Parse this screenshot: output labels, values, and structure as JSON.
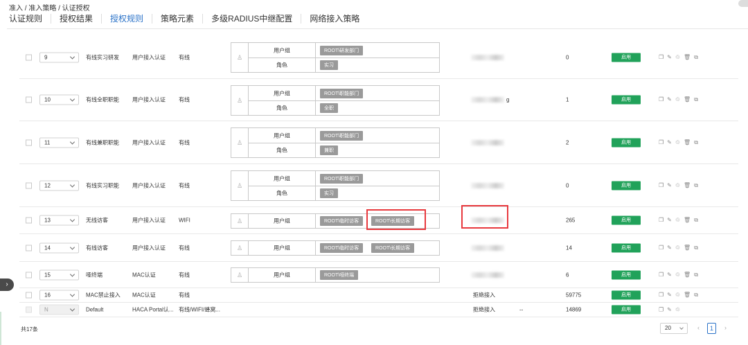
{
  "breadcrumb": "准入 / 准入策略 / 认证授权",
  "tabs": [
    "认证规则",
    "授权结果",
    "授权规则",
    "策略元素",
    "多级RADIUS中继配置",
    "网络接入策略"
  ],
  "active_tab": 2,
  "labels": {
    "user_group": "用户组",
    "role": "角色"
  },
  "rows": [
    {
      "num": "9",
      "name": "有线实习研发",
      "auth": "用户接入认证",
      "conn": "有线",
      "group_tags": [
        "ROOT\\研发部门"
      ],
      "role_tags": [
        "实习"
      ],
      "result": "",
      "count": "0",
      "status": "启用"
    },
    {
      "num": "10",
      "name": "有线全职职能",
      "auth": "用户接入认证",
      "conn": "有线",
      "group_tags": [
        "ROOT\\职能部门"
      ],
      "role_tags": [
        "全职"
      ],
      "result": "g",
      "count": "1",
      "status": "启用"
    },
    {
      "num": "11",
      "name": "有线兼职职能",
      "auth": "用户接入认证",
      "conn": "有线",
      "group_tags": [
        "ROOT\\职能部门"
      ],
      "role_tags": [
        "兼职"
      ],
      "result": "",
      "count": "2",
      "status": "启用"
    },
    {
      "num": "12",
      "name": "有线实习职能",
      "auth": "用户接入认证",
      "conn": "有线",
      "group_tags": [
        "ROOT\\职能部门"
      ],
      "role_tags": [
        "实习"
      ],
      "result": "",
      "count": "0",
      "status": "启用"
    },
    {
      "num": "13",
      "name": "无线访客",
      "auth": "用户接入认证",
      "conn": "WIFI",
      "group_tags": [
        "ROOT\\临时访客",
        "ROOT\\长期访客"
      ],
      "role_tags": [],
      "result": "",
      "count": "265",
      "status": "启用"
    },
    {
      "num": "14",
      "name": "有线访客",
      "auth": "用户接入认证",
      "conn": "有线",
      "group_tags": [
        "ROOT\\临时访客",
        "ROOT\\长期访客"
      ],
      "role_tags": [],
      "result": "",
      "count": "14",
      "status": "启用"
    },
    {
      "num": "15",
      "name": "哑终端",
      "auth": "MAC认证",
      "conn": "有线",
      "group_tags": [
        "ROOT\\哑终端"
      ],
      "role_tags": [],
      "result": "",
      "count": "6",
      "status": "启用"
    },
    {
      "num": "16",
      "name": "MAC禁止接入",
      "auth": "MAC认证",
      "conn": "有线",
      "group_tags": [],
      "role_tags": [],
      "result": "拒绝接入",
      "extra": "",
      "count": "59775",
      "status": "启用"
    },
    {
      "num": "N",
      "name": "Default",
      "auth": "HACA Portal认...",
      "conn": "有线/WIFI/蜂窝...",
      "group_tags": [],
      "role_tags": [],
      "result": "拒绝接入",
      "extra": "--",
      "count": "14869",
      "status": "启用"
    }
  ],
  "footer": {
    "total": "共17条",
    "page_size": "20",
    "current_page": "1",
    "prev": "‹",
    "next": "›"
  },
  "icons": [
    "copy-icon",
    "edit-icon",
    "delete-icon",
    "trash-icon",
    "clipboard-icon"
  ],
  "colors": {
    "accent": "#2a72c8",
    "enabled": "#21a25a",
    "highlight": "#e8383d",
    "tag": "#9a9a9a"
  }
}
